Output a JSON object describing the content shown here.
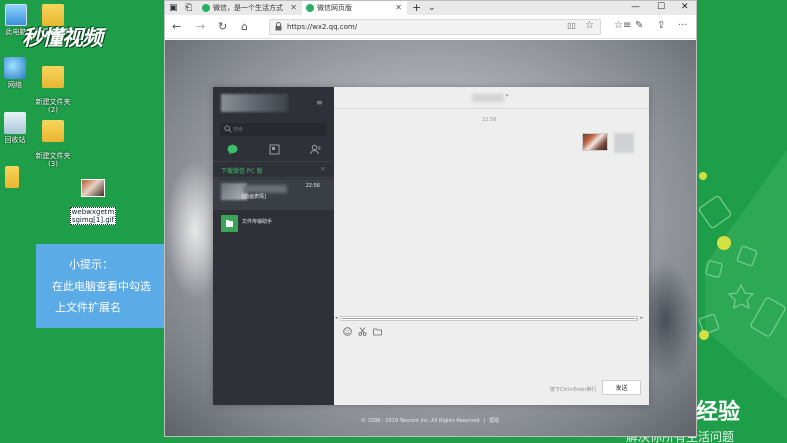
{
  "desktop": {
    "icons": [
      {
        "label": "此电脑",
        "icon": "computer-icon"
      },
      {
        "label": "网络",
        "icon": "network-icon"
      },
      {
        "label": "回收站",
        "icon": "recycle-bin-icon"
      },
      {
        "label": "新建文件夹",
        "icon": "folder-icon"
      },
      {
        "label": "新建文件夹\n(2)",
        "icon": "folder-icon"
      },
      {
        "label": "新建文件夹\n(3)",
        "icon": "folder-icon"
      },
      {
        "label": "webwxgetm\nsgimg[1].gif",
        "icon": "image-file-icon"
      }
    ],
    "watermark_logo": "秒懂视频",
    "tip": {
      "line1": "小提示：",
      "line2": "在此电脑查看中勾选",
      "line3": "上文件扩展名"
    },
    "right_logo": "经验",
    "right_sub": "解决你所有生活问题",
    "colors": {
      "desktop_green": "#1f9e4a",
      "tip_blue": "#5aabe6",
      "accent_yellow": "#d5e043"
    }
  },
  "browser": {
    "tabs": [
      {
        "label": "微信，是一个生活方式",
        "active": false
      },
      {
        "label": "微信网页版",
        "active": true
      }
    ],
    "new_tab": "+",
    "tab_dropdown": "⌄",
    "window_controls": {
      "minimize": "—",
      "maximize": "☐",
      "close": "✕"
    },
    "url": "https://wx2.qq.com/",
    "nav": {
      "back": "←",
      "forward": "→",
      "refresh": "↻",
      "home": "⌂"
    },
    "footer": {
      "copyright": "© 1998 - 2019 Tencent Inc. All Rights Reserved",
      "separator": "|",
      "help": "帮助"
    }
  },
  "wechat": {
    "search_placeholder": "搜索",
    "menu": "≡",
    "download_banner": "下载微信 PC 版",
    "download_close": "×",
    "chats": [
      {
        "name": "",
        "time": "22:56",
        "message": "[动画表情]",
        "active": true
      },
      {
        "name": "文件传输助手",
        "time": "",
        "message": "",
        "active": false
      }
    ],
    "conversation": {
      "title_caret": "▾",
      "timestamp": "22:56"
    },
    "scroll_left": "◂",
    "scroll_right": "▸",
    "input_hint": "按下Ctrl+Enter换行",
    "send_label": "发送",
    "colors": {
      "sidebar": "#2e3238",
      "green": "#3cbf6c"
    }
  }
}
